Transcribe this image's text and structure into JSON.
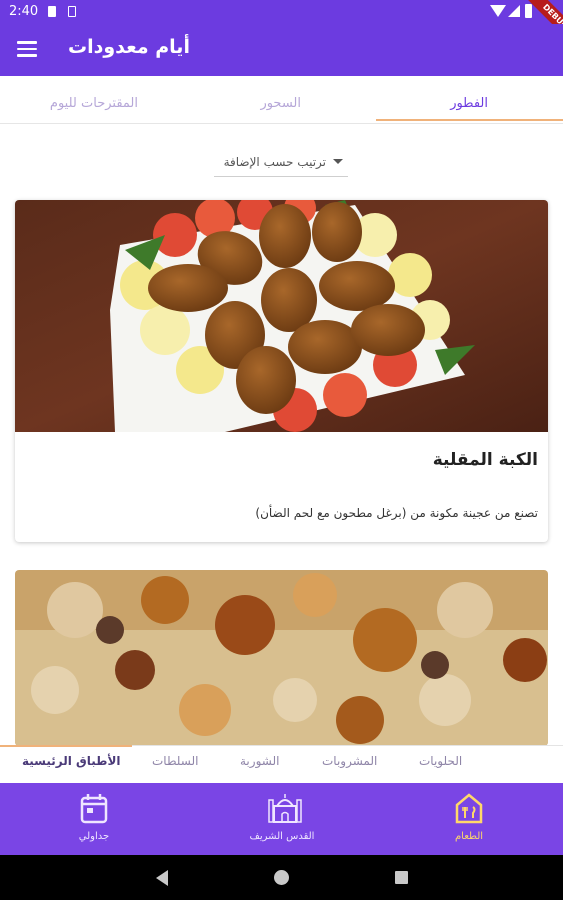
{
  "status_bar": {
    "time": "2:40",
    "debug_label": "DEBUG"
  },
  "app_bar": {
    "title": "أيام معدودات"
  },
  "tabs": [
    {
      "label": "الفطور",
      "active": true
    },
    {
      "label": "السحور",
      "active": false
    },
    {
      "label": "المقترحات لليوم",
      "active": false
    }
  ],
  "sort": {
    "label": "ترتيب حسب الإضافة"
  },
  "cards": [
    {
      "title": "الكبة المقلية",
      "description": "تصنع من عجينة مكونة من (برغل مطحون مع لحم الضأن)"
    }
  ],
  "categories": [
    {
      "label": "الأطباق الرئيسية",
      "active": true
    },
    {
      "label": "السلطات",
      "active": false
    },
    {
      "label": "الشوربة",
      "active": false
    },
    {
      "label": "المشروبات",
      "active": false
    },
    {
      "label": "الحلويات",
      "active": false
    }
  ],
  "bottom_nav": [
    {
      "label": "الطعام",
      "icon": "restaurant-icon",
      "active": true
    },
    {
      "label": "القدس الشريف",
      "icon": "mosque-icon",
      "active": false
    },
    {
      "label": "جداولي",
      "icon": "calendar-icon",
      "active": false
    }
  ],
  "colors": {
    "primary": "#6c3be0",
    "bottom_nav": "#7a45e5",
    "indicator": "#f0b27a",
    "active_nav": "#ffd86a"
  }
}
